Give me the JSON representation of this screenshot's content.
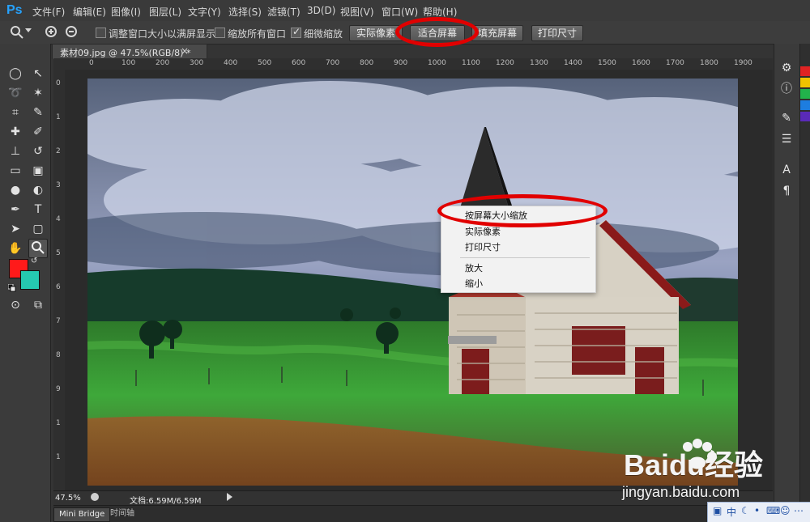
{
  "app": {
    "logo_text": "Ps"
  },
  "menubar": {
    "items": [
      "文件(F)",
      "编辑(E)",
      "图像(I)",
      "图层(L)",
      "文字(Y)",
      "选择(S)",
      "滤镜(T)",
      "3D(D)",
      "视图(V)",
      "窗口(W)",
      "帮助(H)"
    ]
  },
  "options": {
    "checkboxes": [
      {
        "label": "调整窗口大小以满屏显示",
        "checked": false
      },
      {
        "label": "缩放所有窗口",
        "checked": false
      },
      {
        "label": "细微缩放",
        "checked": true
      }
    ],
    "buttons": [
      "实际像素",
      "适合屏幕",
      "填充屏幕",
      "打印尺寸"
    ]
  },
  "document": {
    "tab_title": "素材09.jpg @ 47.5%(RGB/8) *",
    "tab_close": "×",
    "zoom": "47.5%",
    "doc_info": "文档:6.59M/6.59M"
  },
  "rulers": {
    "top_labels": [
      "0",
      "100",
      "200",
      "300",
      "400",
      "500",
      "600",
      "700",
      "800",
      "900",
      "1000",
      "1100",
      "1200",
      "1300",
      "1400",
      "1500",
      "1600",
      "1700",
      "1800",
      "1900"
    ],
    "left_labels": [
      "0",
      "1",
      "2",
      "3",
      "4",
      "5",
      "6",
      "7",
      "8",
      "9",
      "1",
      "1"
    ]
  },
  "context_menu": {
    "items": [
      "按屏幕大小缩放",
      "实际像素",
      "打印尺寸",
      "放大",
      "缩小"
    ]
  },
  "bottom_tabs": [
    "Mini Bridge",
    "时间轴"
  ],
  "watermark": {
    "line1": "Baidu经验",
    "line2": "jingyan.baidu.com"
  },
  "tray": {
    "items": [
      "中"
    ]
  },
  "colors": {
    "highlight_red": "#e10000",
    "foreground": "#ff1a1a",
    "background": "#25c9b1",
    "swatches": [
      "#e02323",
      "#f0c300",
      "#22b34b",
      "#1d7de0",
      "#5a2ab8"
    ]
  }
}
